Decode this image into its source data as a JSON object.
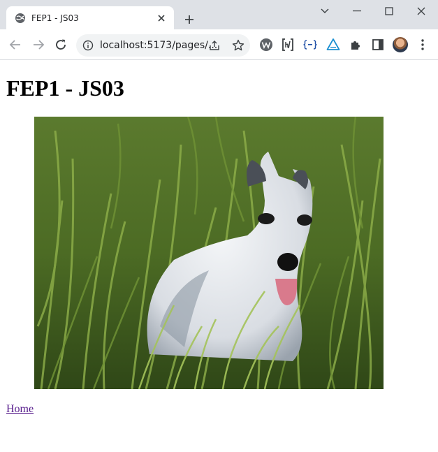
{
  "browser": {
    "tab": {
      "title": "FEP1 - JS03",
      "favicon": "globe-icon"
    },
    "address_bar": {
      "url": "localhost:5173/pages/..."
    },
    "extensions": [
      "w-extension-icon",
      "html-extension-icon",
      "json-extension-icon",
      "triangle-extension-icon",
      "puzzle-extensions-icon",
      "side-panel-icon"
    ]
  },
  "page": {
    "heading": "FEP1 - JS03",
    "image": {
      "subject": "white-greyhound-lying-in-grass-photo"
    },
    "link": "Home"
  }
}
